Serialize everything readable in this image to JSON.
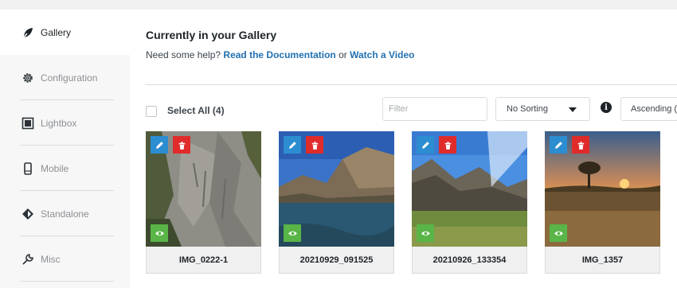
{
  "sidebar": {
    "items": [
      {
        "label": "Gallery",
        "icon": "leaf-icon",
        "active": true
      },
      {
        "label": "Configuration",
        "icon": "gear-icon"
      },
      {
        "label": "Lightbox",
        "icon": "lightbox-icon"
      },
      {
        "label": "Mobile",
        "icon": "mobile-icon"
      },
      {
        "label": "Standalone",
        "icon": "standalone-icon"
      },
      {
        "label": "Misc",
        "icon": "wrench-icon"
      }
    ]
  },
  "main": {
    "title": "Currently in your Gallery",
    "help_prefix": "Need some help?",
    "help_link_docs": "Read the Documentation",
    "help_or": "or",
    "help_link_video": "Watch a Video"
  },
  "toolbar": {
    "select_all_label": "Select All (4)",
    "filter_placeholder": "Filter",
    "sorting_value": "No Sorting",
    "order_value": "Ascending (",
    "info_icon": "info-icon"
  },
  "gallery": {
    "items": [
      {
        "caption": "IMG_0222-1"
      },
      {
        "caption": "20210929_091525"
      },
      {
        "caption": "20210926_133354"
      },
      {
        "caption": "IMG_1357"
      }
    ]
  },
  "colors": {
    "edit_button": "#2c8dd1",
    "delete_button": "#e02b2b",
    "view_button": "#59b547",
    "link": "#2271b1"
  }
}
